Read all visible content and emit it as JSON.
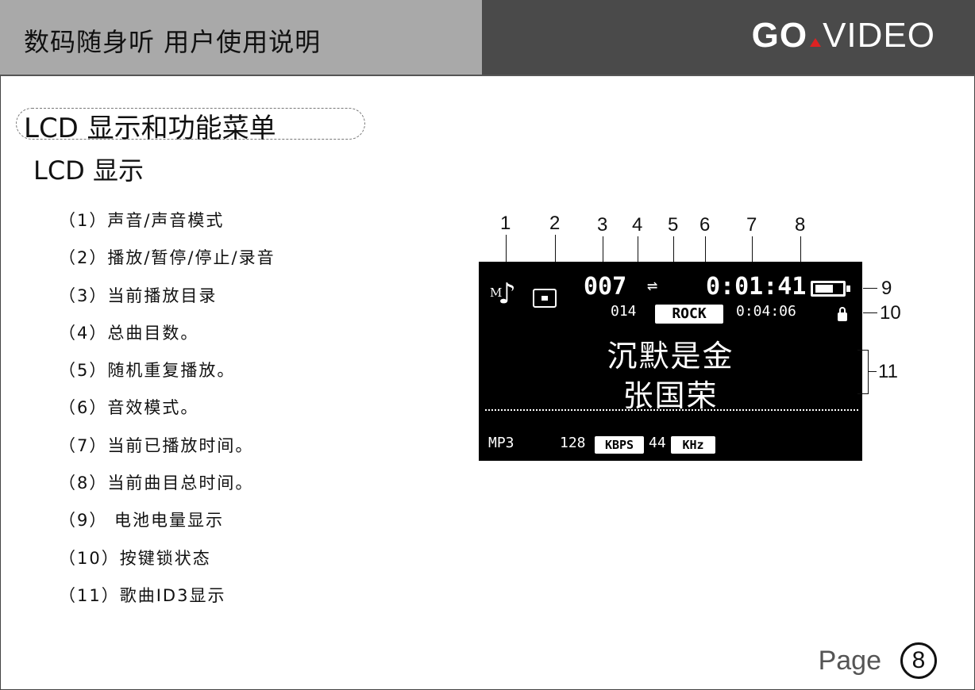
{
  "header": {
    "title": "数码随身听 用户使用说明",
    "logo_go": "GO",
    "logo_video": "VIDEO"
  },
  "section": {
    "title": "LCD 显示和功能菜单",
    "subtitle": "LCD 显示"
  },
  "legend": [
    "（1）声音/声音模式",
    "（2）播放/暂停/停止/录音",
    "（3）当前播放目录",
    "（4）总曲目数。",
    "（5）随机重复播放。",
    "（6）音效模式。",
    "（7）当前已播放时间。",
    "（8）当前曲目总时间。",
    "（9） 电池电量显示",
    "（10）按键锁状态",
    "（11）歌曲ID3显示"
  ],
  "diagram": {
    "callouts_top": [
      "1",
      "2",
      "3",
      "4",
      "5",
      "6",
      "7",
      "8"
    ],
    "callout_9": "9",
    "callout_10": "10",
    "callout_11": "11",
    "lcd": {
      "mode_letter": "M",
      "folder": "007",
      "elapsed": "0:01:41",
      "track_total": "014",
      "eq_mode": "ROCK",
      "total_time": "0:04:06",
      "song_title": "沉默是金",
      "artist": "张国荣",
      "format": "MP3",
      "bitrate": "128",
      "bitrate_unit": "KBPS",
      "sample_rate": "44",
      "sample_unit": "KHz"
    }
  },
  "footer": {
    "page_label": "Page",
    "page_number": "8"
  },
  "colors": {
    "header_left_bg": "#a9a9a9",
    "header_right_bg": "#4a4a4a",
    "logo_accent": "#dd2222",
    "lcd_bg": "#000000"
  }
}
